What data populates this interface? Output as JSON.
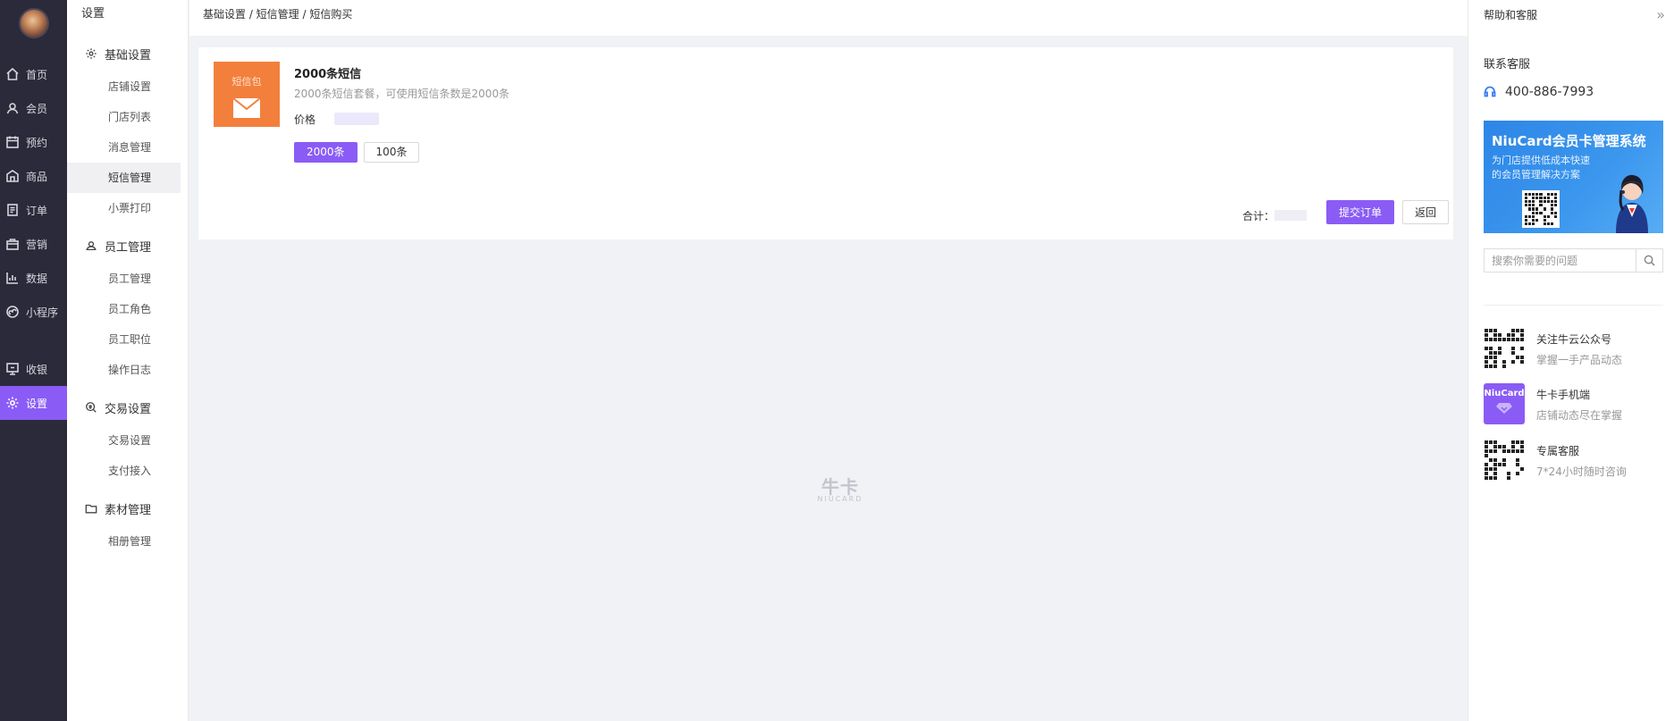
{
  "left_nav": {
    "items": [
      {
        "label": "首页",
        "icon": "home-icon"
      },
      {
        "label": "会员",
        "icon": "member-icon"
      },
      {
        "label": "预约",
        "icon": "calendar-icon"
      },
      {
        "label": "商品",
        "icon": "shop-icon"
      },
      {
        "label": "订单",
        "icon": "order-icon"
      },
      {
        "label": "营销",
        "icon": "marketing-icon"
      },
      {
        "label": "数据",
        "icon": "chart-icon"
      },
      {
        "label": "小程序",
        "icon": "mini-program-icon"
      },
      {
        "label": "收银",
        "icon": "cashier-icon"
      },
      {
        "label": "设置",
        "icon": "gear-icon"
      }
    ],
    "active_color": "#8a5cf5"
  },
  "sub_nav": {
    "title": "设置",
    "groups": [
      {
        "label": "基础设置",
        "items": [
          "店铺设置",
          "门店列表",
          "消息管理",
          "短信管理",
          "小票打印"
        ]
      },
      {
        "label": "员工管理",
        "items": [
          "员工管理",
          "员工角色",
          "员工职位",
          "操作日志"
        ]
      },
      {
        "label": "交易设置",
        "items": [
          "交易设置",
          "支付接入"
        ]
      },
      {
        "label": "素材管理",
        "items": [
          "相册管理"
        ]
      }
    ],
    "active_item": "短信管理"
  },
  "breadcrumb": "基础设置 / 短信管理 / 短信购买",
  "product": {
    "image_tag": "短信包",
    "name": "2000条短信",
    "desc": "2000条短信套餐，可使用短信条数是2000条",
    "price_label": "价格",
    "options": [
      "2000条",
      "100条"
    ],
    "selected_option": "2000条"
  },
  "footer": {
    "total_label": "合计：",
    "submit_label": "提交订单",
    "back_label": "返回"
  },
  "watermark": {
    "big": "牛卡",
    "small": "NIUCARD"
  },
  "help": {
    "title": "帮助和客服",
    "contact_title": "联系客服",
    "phone": "400-886-7993",
    "banner_title": "NiuCard会员卡管理系统",
    "banner_sub1": "为门店提供低成本快速",
    "banner_sub2": "的会员管理解决方案",
    "search_placeholder": "搜索你需要的问题",
    "items": [
      {
        "title": "关注牛云公众号",
        "sub": "掌握一手产品动态"
      },
      {
        "title": "牛卡手机端",
        "sub": "店铺动态尽在掌握",
        "icon_label": "NiuCard"
      },
      {
        "title": "专属客服",
        "sub": "7*24小时随时咨询"
      }
    ]
  }
}
